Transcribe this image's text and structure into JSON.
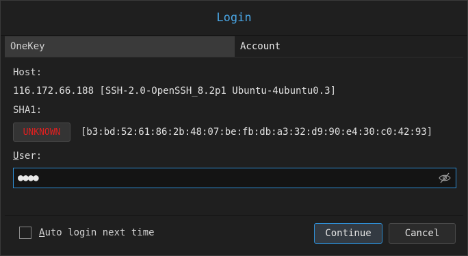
{
  "window": {
    "title": "Login"
  },
  "tabs": [
    {
      "label": "OneKey",
      "active": false
    },
    {
      "label": "Account",
      "active": true
    }
  ],
  "host": {
    "label": "Host:",
    "value": "116.172.66.188 [SSH-2.0-OpenSSH_8.2p1 Ubuntu-4ubuntu0.3]"
  },
  "sha1": {
    "label": "SHA1:",
    "status": "UNKNOWN",
    "fingerprint": "[b3:bd:52:61:86:2b:48:07:be:fb:db:a3:32:d9:90:e4:30:c0:42:93]"
  },
  "user": {
    "label": "User:",
    "value": "●●●●"
  },
  "auto_login": {
    "label": "Auto login next time",
    "checked": false
  },
  "buttons": {
    "continue": "Continue",
    "cancel": "Cancel"
  },
  "colors": {
    "accent": "#2f8fd6",
    "title": "#4aa8e8",
    "warning": "#e21f1f"
  }
}
